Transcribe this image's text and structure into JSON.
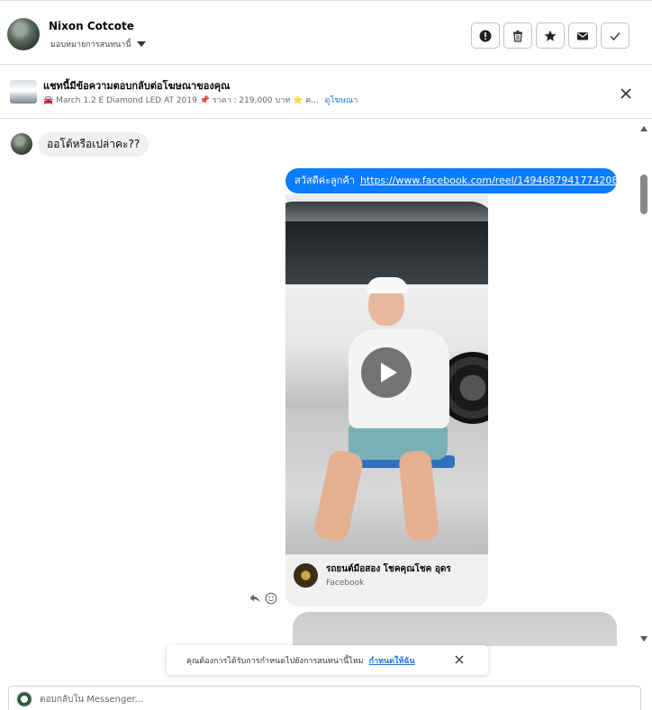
{
  "header": {
    "contact_name": "Nixon Cotcote",
    "assign_label": "มอบหมายการสนทนานี้"
  },
  "ad": {
    "title": "แชทนี้มีข้อความตอบกลับต่อโฆษณาของคุณ",
    "subtitle": "🚘 March 1.2 E Diamond LED AT 2019 📌 ราคา : 219,000 บาท ⭐ ค...",
    "link": "ดูโฆษณา"
  },
  "messages": {
    "incoming_text": "ออโต้หรือเปล่าคะ??",
    "outgoing_greeting": "สวัสดีค่ะลูกค้า",
    "outgoing_url": "https://www.facebook.com/reel/1494687941774208",
    "card_title": "รถยนต์มือสอง โชคคุณโชค อุดร",
    "card_source": "Facebook"
  },
  "notice": {
    "text": "คุณต้องการได้รับการกำหนดไปยังการสนทนานี้ไหม",
    "action": "กำหนดให้ฉัน"
  },
  "reply": {
    "placeholder": "ตอบกลับใน Messenger..."
  },
  "icons": {
    "header_buttons": [
      "alert-icon",
      "trash-icon",
      "star-icon",
      "mail-icon",
      "check-icon"
    ]
  },
  "colors": {
    "accent": "#0a7cff",
    "link": "#1b74e4"
  }
}
